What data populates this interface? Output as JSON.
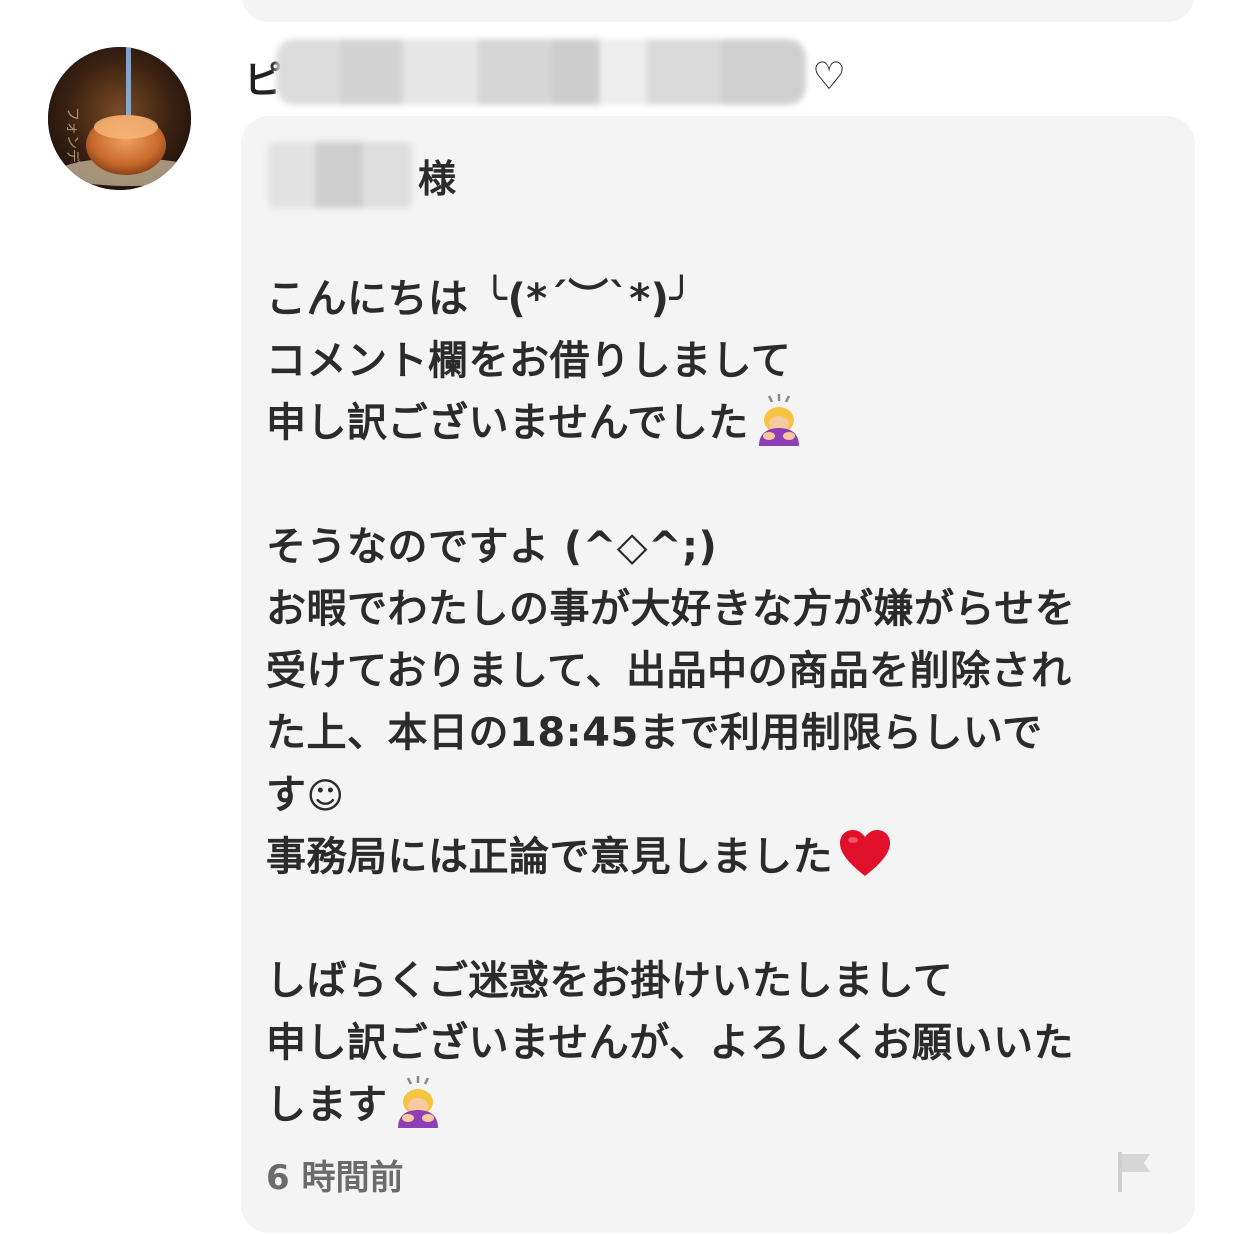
{
  "comment": {
    "username_prefix": "ピ",
    "username_suffix": "♡",
    "addressee_suffix": "様",
    "lines": [
      "こんにちは ╰(*´︶`*)╯",
      "コメント欄をお借りしまして",
      "申し訳ございませんでした",
      "",
      "そうなのですよ (^◇^;)",
      "お暇でわたしの事が大好きな方が嫌がらせを",
      "受けておりまして、出品中の商品を削除され",
      "た上、本日の18:45まで利用制限らしいで",
      "す",
      "事務局には正論で意見しました",
      "",
      "しばらくご迷惑をお掛けいたしまして",
      "申し訳ございませんが、よろしくお願いいた",
      "します"
    ],
    "smiley_glyph": "☺",
    "timestamp": "6 時間前",
    "icons": {
      "bow_emoji": "person-bowing-icon",
      "heart_emoji": "red-heart-icon",
      "report": "flag-icon"
    },
    "colors": {
      "bubble_bg": "#f4f4f4",
      "text": "#2b2b2b",
      "timestamp": "#6b6b6b",
      "heart": "#e0102a"
    }
  }
}
